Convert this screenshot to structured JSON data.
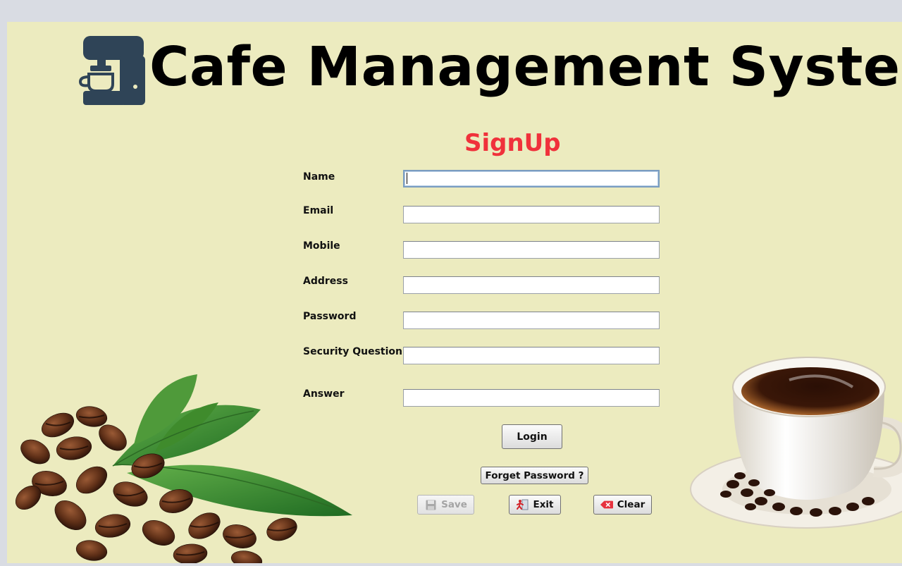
{
  "header": {
    "app_title": "Cafe Management System",
    "logo_icon": "coffee-machine-icon",
    "logo_color": "#2f4457"
  },
  "form": {
    "title": "SignUp",
    "title_color": "#f0313b",
    "fields": [
      {
        "label": "Name",
        "value": "",
        "focused": true
      },
      {
        "label": "Email",
        "value": ""
      },
      {
        "label": "Mobile",
        "value": ""
      },
      {
        "label": "Address",
        "value": ""
      },
      {
        "label": "Password",
        "value": ""
      },
      {
        "label": "Security Question",
        "value": ""
      },
      {
        "label": "Answer",
        "value": ""
      }
    ]
  },
  "buttons": {
    "login": "Login",
    "forget_password": "Forget Password ?",
    "save": "Save",
    "save_enabled": false,
    "save_icon": "floppy-disk-icon",
    "exit": "Exit",
    "exit_icon": "exit-door-icon",
    "clear": "Clear",
    "clear_icon": "clear-x-icon"
  },
  "colors": {
    "background": "#ecebbf",
    "outer": "#d9dce3"
  }
}
